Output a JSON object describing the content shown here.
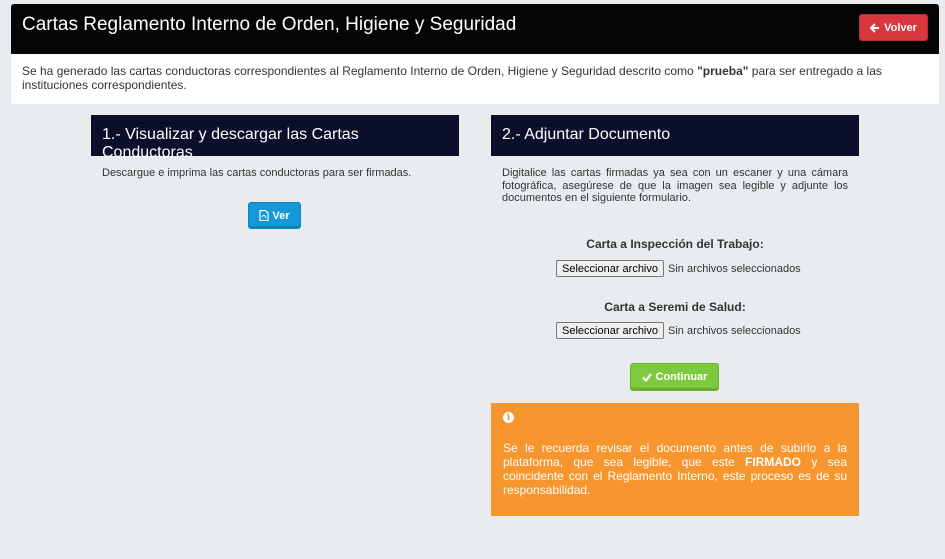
{
  "header": {
    "title": "Cartas Reglamento Interno de Orden, Higiene y Seguridad",
    "back_button": "Volver"
  },
  "info": {
    "text_before": "Se ha generado las cartas conductoras correspondientes al Reglamento Interno de Orden, Higiene y Seguridad descrito como ",
    "highlight": "\"prueba\"",
    "text_after": " para ser entregado a las instituciones correspondientes."
  },
  "section1": {
    "title": "1.- Visualizar y descargar las Cartas Conductoras",
    "description": "Descargue e imprima las cartas conductoras para ser firmadas.",
    "view_button": "Ver"
  },
  "section2": {
    "title": "2.- Adjuntar Documento",
    "description": "Digitalice las cartas firmadas ya sea con un escaner y una cámara fotográfica, asegúrese de que la imagen sea legible y adjunte los documentos en el siguiente formulario.",
    "fields": [
      {
        "label": "Carta a Inspección del Trabajo:",
        "button": "Seleccionar archivo",
        "status": "Sin archivos seleccionados"
      },
      {
        "label": "Carta a Seremi de Salud:",
        "button": "Seleccionar archivo",
        "status": "Sin archivos seleccionados"
      }
    ],
    "continue_button": "Continuar"
  },
  "alert": {
    "text_before": "Se le recuerda revisar el documento antes de subirlo a la plataforma, que sea legible, que este ",
    "emphasis": "FIRMADO",
    "text_after": " y sea coincidente con el Reglamento Interno, este proceso es de su responsabilidad.",
    "color": "#f7952f"
  },
  "colors": {
    "header_bg": "#050505",
    "section_header_bg": "#0b0f2c",
    "danger": "#d9363e",
    "info_button": "#1598d8",
    "success": "#7dc940"
  }
}
